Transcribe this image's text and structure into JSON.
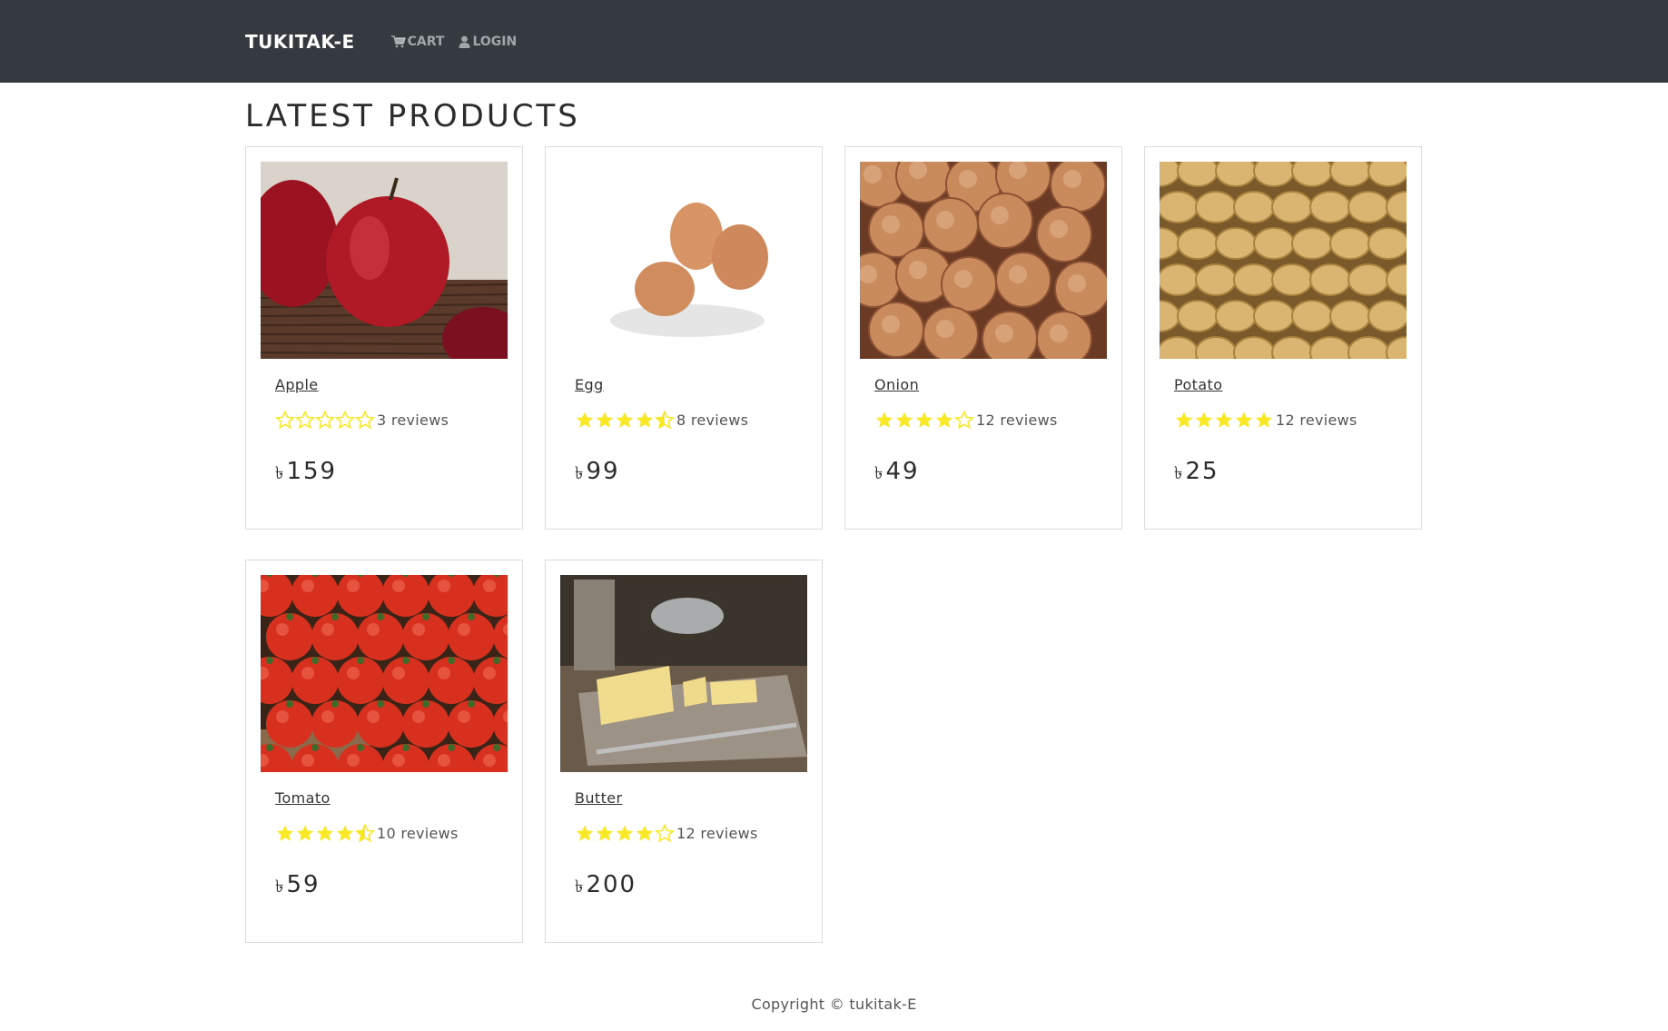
{
  "header": {
    "brand": "TUKITAK-E",
    "cart_label": "CART",
    "login_label": "LOGIN",
    "background": "#343a40"
  },
  "main": {
    "title": "LATEST PRODUCTS",
    "currency_symbol": "৳",
    "star_color": "#f8e825",
    "products": [
      {
        "name": "Apple",
        "rating": 0,
        "reviews": "3 reviews",
        "price": "159",
        "image": "apple-photo"
      },
      {
        "name": "Egg",
        "rating": 4.5,
        "reviews": "8 reviews",
        "price": "99",
        "image": "egg-photo"
      },
      {
        "name": "Onion",
        "rating": 4,
        "reviews": "12 reviews",
        "price": "49",
        "image": "onion-photo"
      },
      {
        "name": "Potato",
        "rating": 5,
        "reviews": "12 reviews",
        "price": "25",
        "image": "potato-photo"
      },
      {
        "name": "Tomato",
        "rating": 4.5,
        "reviews": "10 reviews",
        "price": "59",
        "image": "tomato-photo"
      },
      {
        "name": "Butter",
        "rating": 4,
        "reviews": "12 reviews",
        "price": "200",
        "image": "butter-photo"
      }
    ]
  },
  "footer": {
    "copyright": "Copyright © tukitak-E"
  }
}
